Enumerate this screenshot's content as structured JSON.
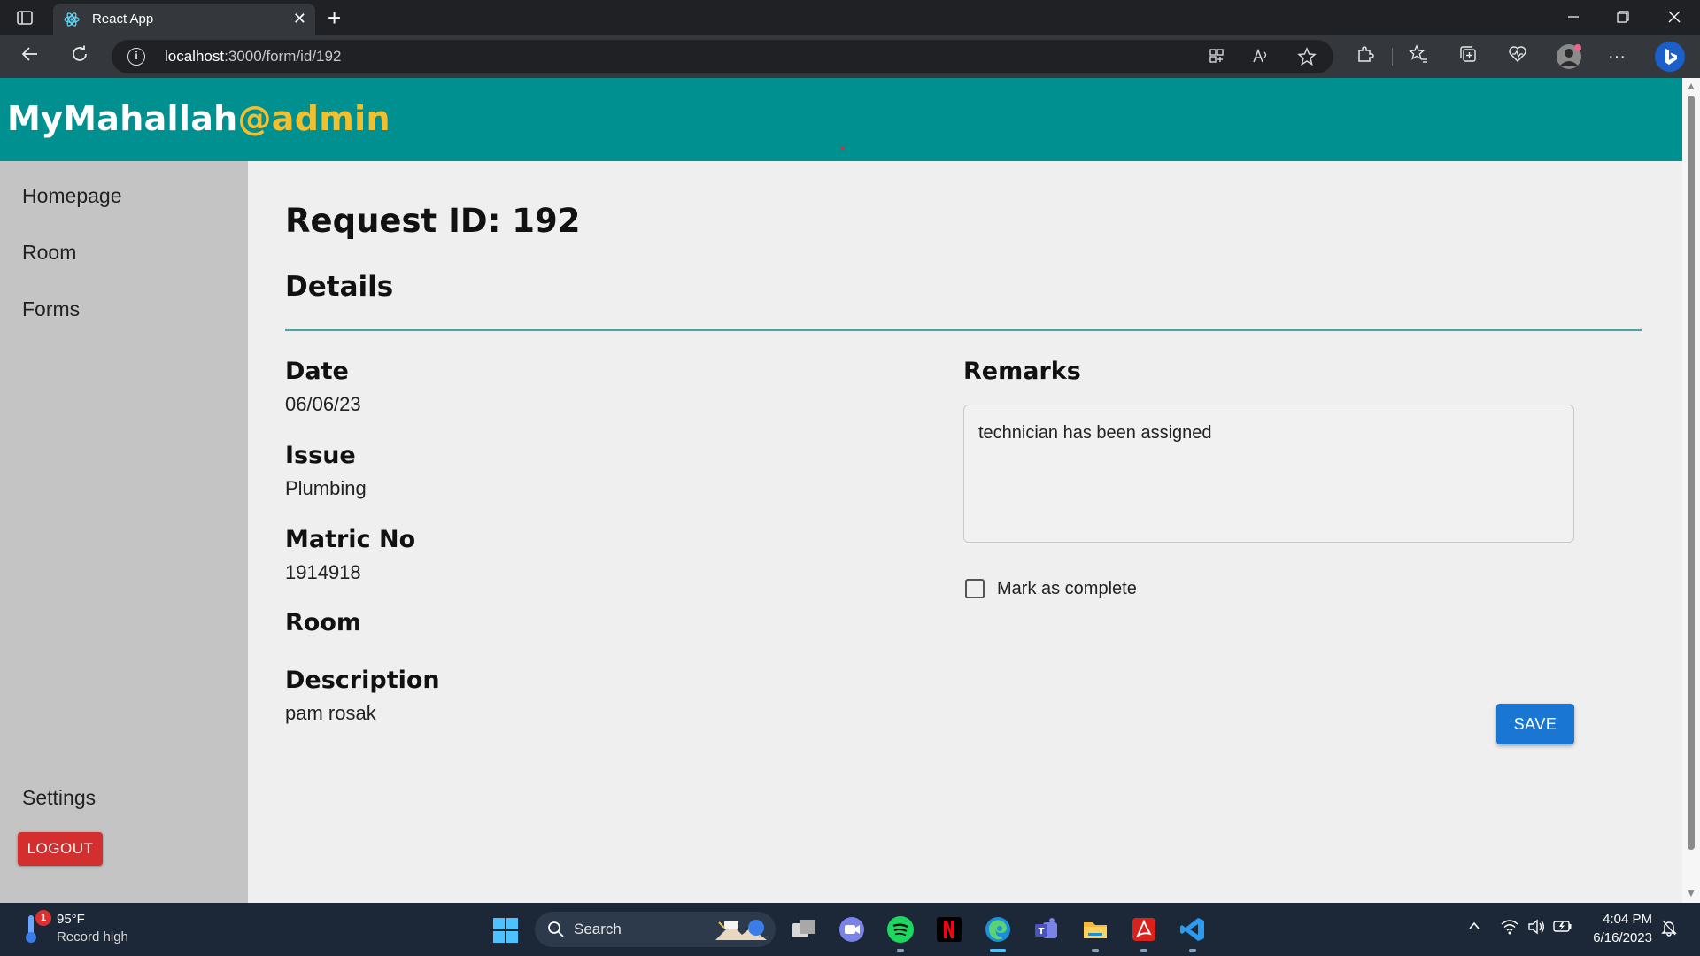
{
  "browser": {
    "tab_title": "React App",
    "new_tab_symbol": "+",
    "close_symbol": "✕",
    "url_host": "localhost",
    "url_path": ":3000/form/id/192",
    "more_symbol": "···"
  },
  "header": {
    "brand_main": "MyMahallah",
    "brand_accent": "@admin",
    "brand_color": "#009090",
    "accent_color": "#f2c02e"
  },
  "sidebar": {
    "items": [
      {
        "label": "Homepage"
      },
      {
        "label": "Room"
      },
      {
        "label": "Forms"
      }
    ],
    "settings_label": "Settings",
    "logout_label": "LOGOUT"
  },
  "main": {
    "title": "Request ID: 192",
    "section_title": "Details",
    "fields": [
      {
        "label": "Date",
        "value": "06/06/23"
      },
      {
        "label": "Issue",
        "value": "Plumbing"
      },
      {
        "label": "Matric No",
        "value": "1914918"
      },
      {
        "label": "Room",
        "value": ""
      },
      {
        "label": "Description",
        "value": "pam rosak"
      }
    ],
    "remarks_label": "Remarks",
    "remarks_value": "technician has been assigned",
    "checkbox_label": "Mark as complete",
    "checkbox_checked": false,
    "save_label": "SAVE"
  },
  "taskbar": {
    "weather_badge": "1",
    "weather_temp": "95°F",
    "weather_desc": "Record high",
    "search_label": "Search",
    "time": "4:04 PM",
    "date": "6/16/2023"
  }
}
